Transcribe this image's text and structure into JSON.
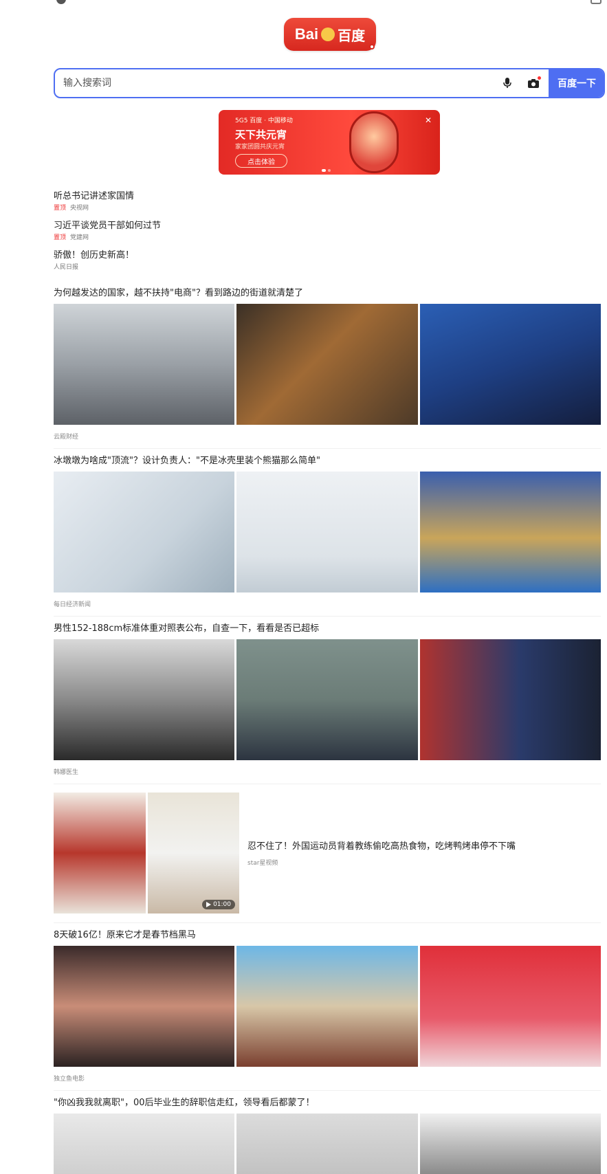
{
  "colors": {
    "brand_blue": "#4e6ef2",
    "brand_red": "#e32a25",
    "tag_red": "#e33"
  },
  "logo": {
    "text_left": "Bai",
    "text_right": "百度"
  },
  "search": {
    "placeholder": "输入搜索词",
    "button_label": "百度一下"
  },
  "banner": {
    "brands": "5G5  百度  ·  中国移动",
    "title": "天下共元宵",
    "subtitle": "家家团圆共庆元宵",
    "cta": "点击体验"
  },
  "hot_news": [
    {
      "title": "听总书记讲述家国情",
      "tag": "置顶",
      "source": "央视网"
    },
    {
      "title": "习近平谈党员干部如何过节",
      "tag": "置顶",
      "source": "党建网"
    },
    {
      "title": "骄傲！创历史新高！",
      "tag": "",
      "source": "人民日报"
    }
  ],
  "feed": [
    {
      "title": "为何越发达的国家，越不扶持\"电商\"？看到路边的街道就清楚了",
      "source": "云殿财经"
    },
    {
      "title": "冰墩墩为啥成\"顶流\"？设计负责人：\"不是冰壳里装个熊猫那么简单\"",
      "source": "每日经济新闻"
    },
    {
      "title": "男性152-188cm标准体重对照表公布，自查一下，看看是否已超标",
      "source": "韩娜医生"
    },
    {
      "title": "8天破16亿！原来它才是春节档黑马",
      "source": "独立鱼电影"
    },
    {
      "title": "\"你凶我我就离职\"，00后毕业生的辞职信走红，领导看后都蒙了！",
      "source": ""
    }
  ],
  "video_item": {
    "title": "忍不住了！外国运动员背着教练偷吃高热食物，吃烤鸭烤串停不下嘴",
    "source": "star星视频",
    "duration": "01:00"
  }
}
